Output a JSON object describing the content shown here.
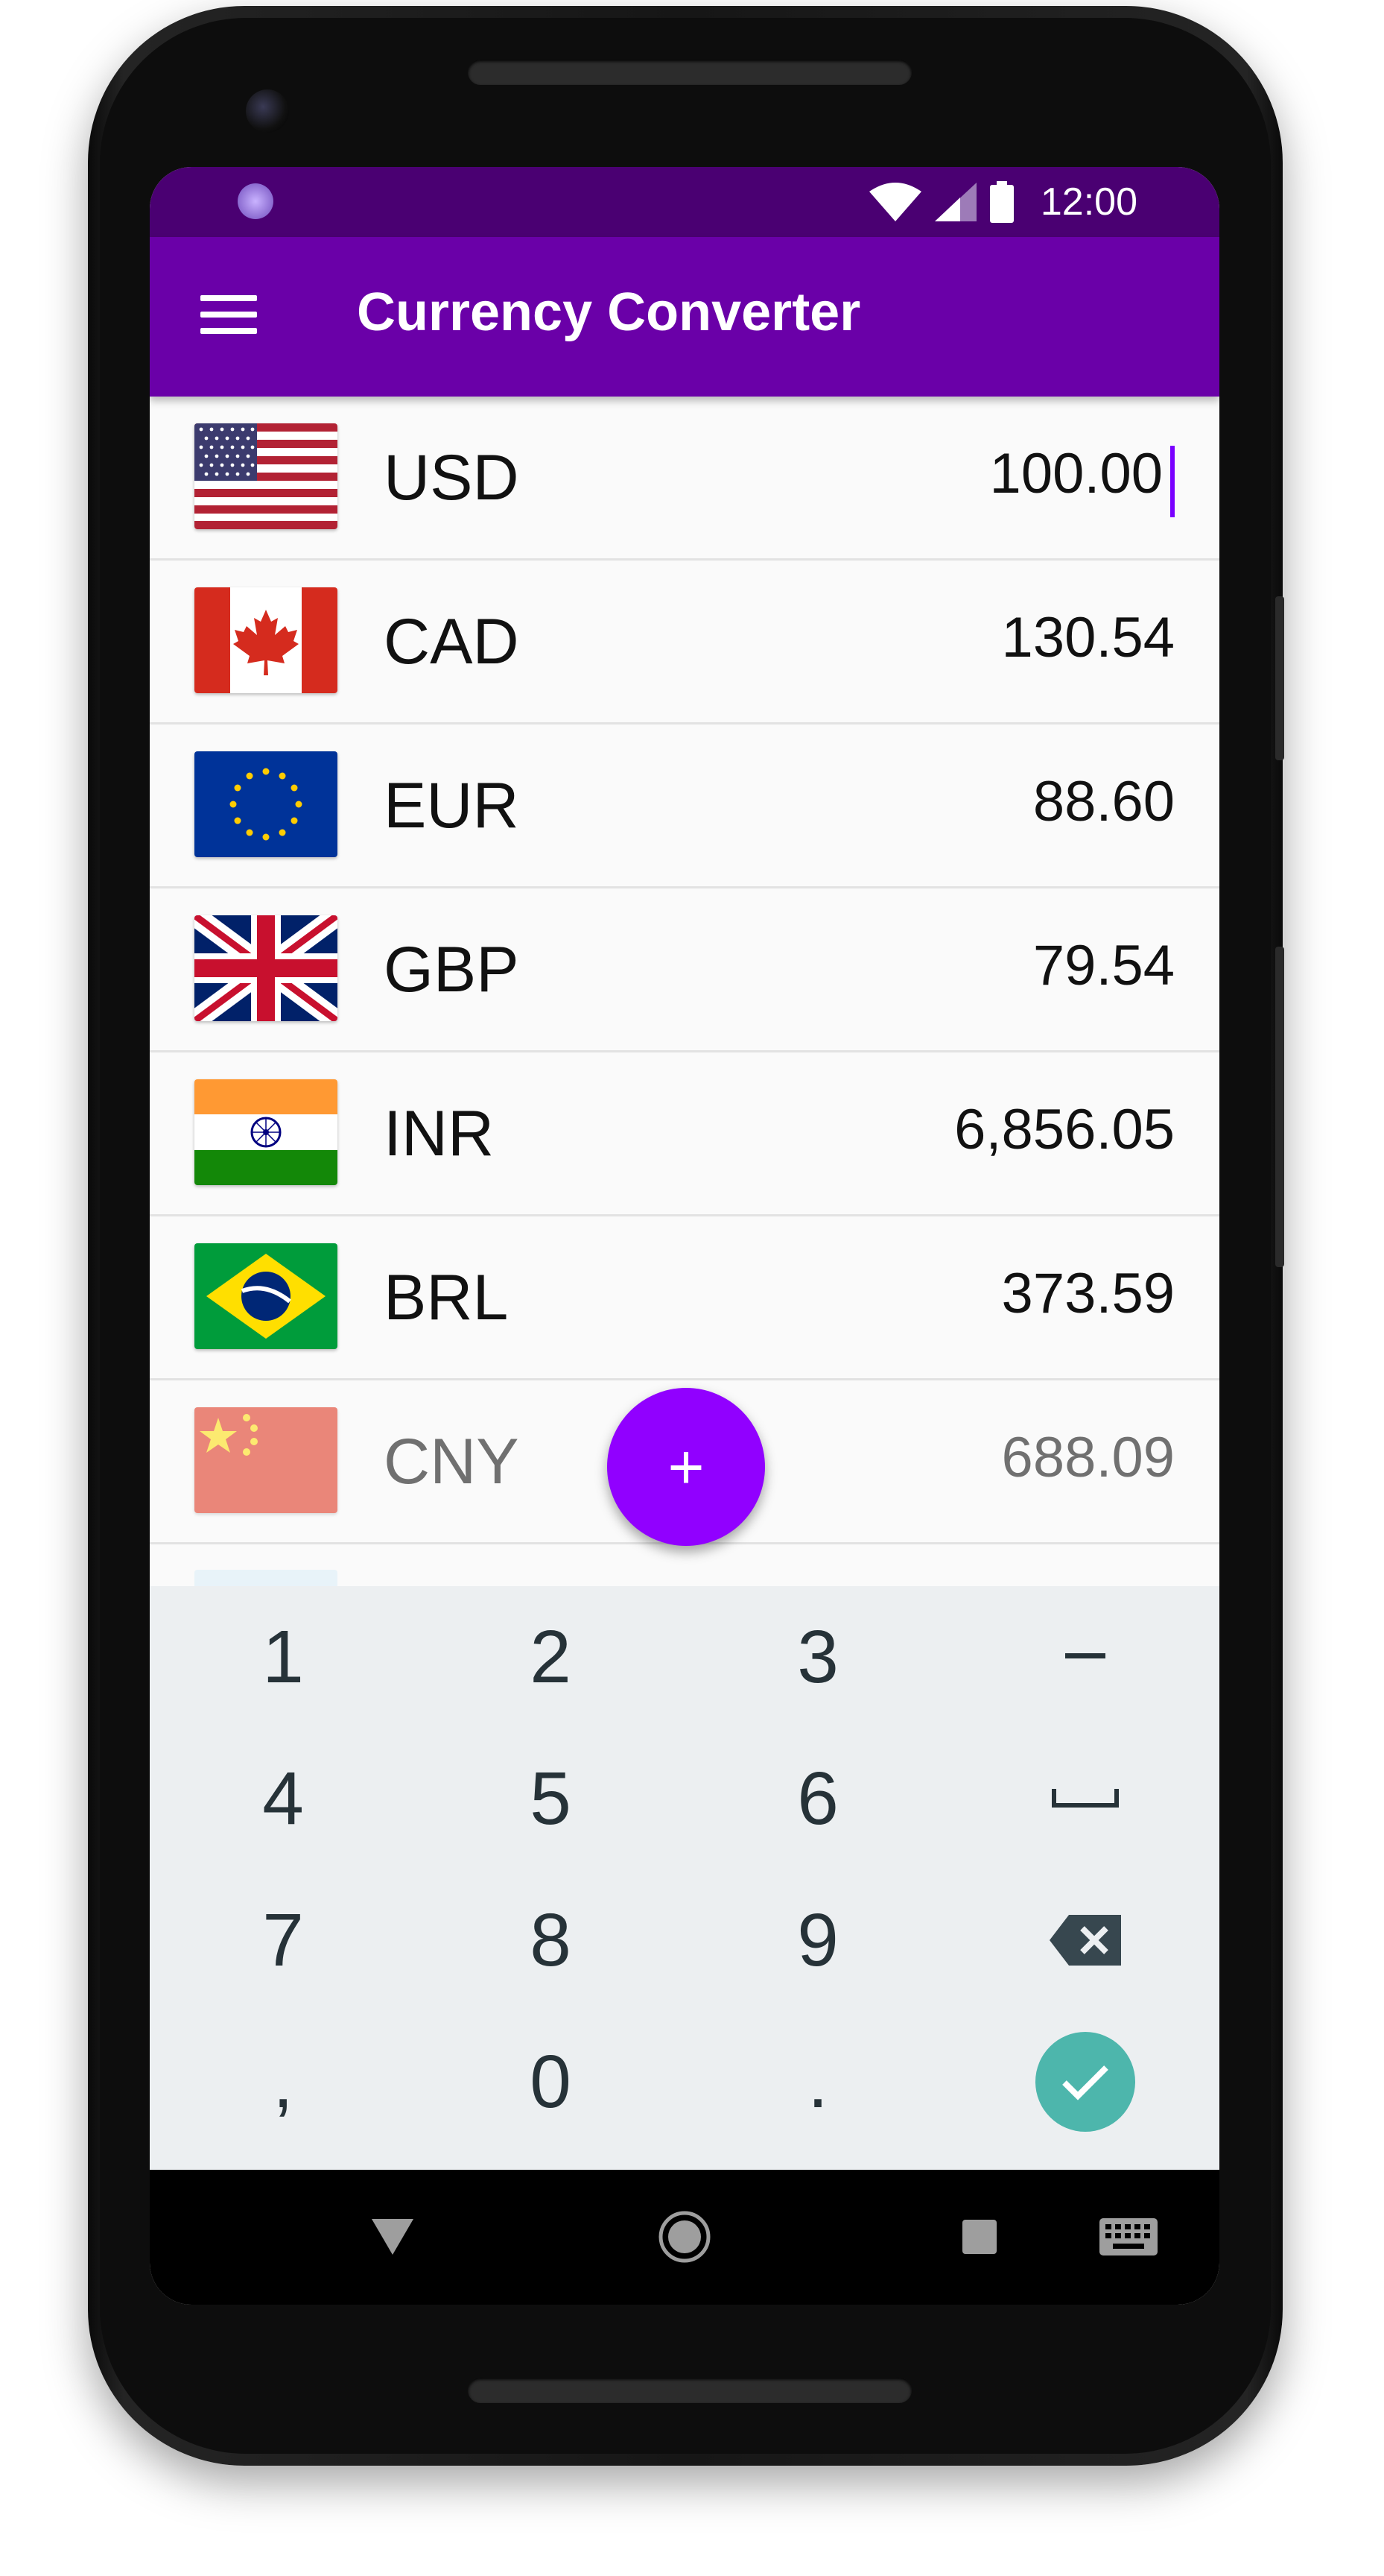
{
  "status_bar": {
    "time": "12:00"
  },
  "app_bar": {
    "title": "Currency Converter"
  },
  "currencies": [
    {
      "code": "USD",
      "amount": "100.00",
      "flag": "us-flag-icon"
    },
    {
      "code": "CAD",
      "amount": "130.54",
      "flag": "canada-flag-icon"
    },
    {
      "code": "EUR",
      "amount": "88.60",
      "flag": "eu-flag-icon"
    },
    {
      "code": "GBP",
      "amount": "79.54",
      "flag": "uk-flag-icon"
    },
    {
      "code": "INR",
      "amount": "6,856.05",
      "flag": "india-flag-icon"
    },
    {
      "code": "BRL",
      "amount": "373.59",
      "flag": "brazil-flag-icon"
    },
    {
      "code": "CNY",
      "amount": "688.09",
      "flag": "china-flag-icon"
    }
  ],
  "fab": {
    "label": "+"
  },
  "keyboard": {
    "keys": [
      "1",
      "2",
      "3",
      "−",
      "4",
      "5",
      "6",
      "␣",
      "7",
      "8",
      "9",
      "⌫",
      ",",
      "0",
      ".",
      "✓"
    ]
  },
  "colors": {
    "status_bar": "#4a0072",
    "app_bar": "#6a00a8",
    "fab": "#9100ff",
    "done_key": "#4db6ac",
    "caret": "#7a00ff"
  }
}
